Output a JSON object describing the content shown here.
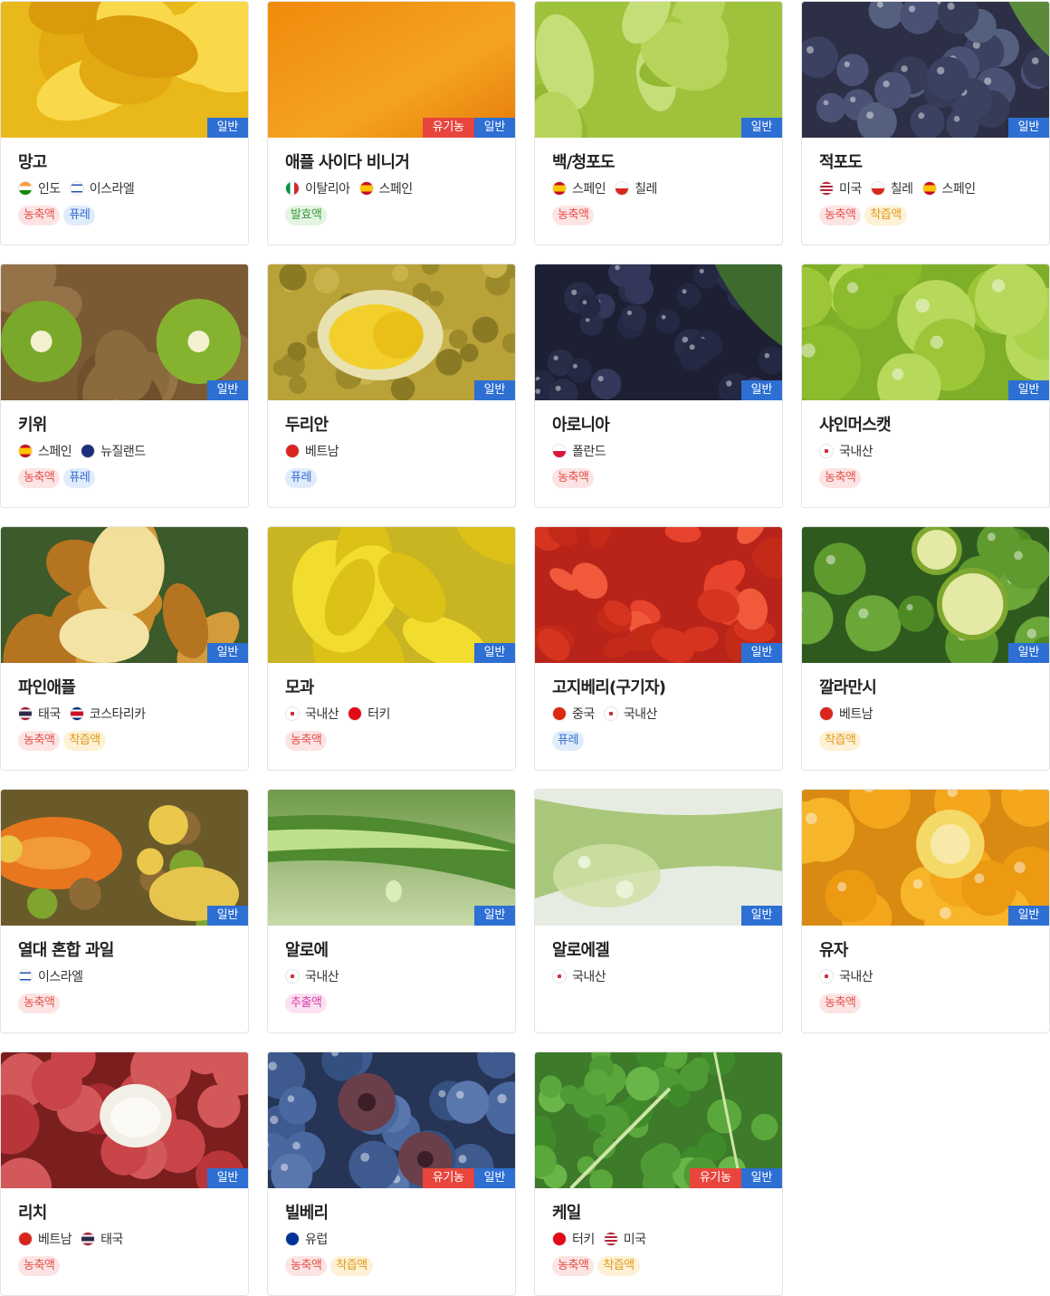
{
  "badge_labels": {
    "general": "일반",
    "organic": "유기농"
  },
  "colors": {
    "general_badge": "#2d6fd3",
    "organic_badge": "#e8453c",
    "tag_concentrate": "#e2524a",
    "tag_puree": "#2e6ad1",
    "tag_fermented": "#3c9a3c",
    "tag_juice": "#e39a1b",
    "tag_extract": "#d93aa8"
  },
  "products": [
    {
      "name": "망고",
      "image": "mango-photo",
      "organic": false,
      "origins": [
        {
          "label": "인도",
          "flag": "india-flag-icon"
        },
        {
          "label": "이스라엘",
          "flag": "israel-flag-icon"
        }
      ],
      "tags": [
        {
          "label": "농축액",
          "type": "conc"
        },
        {
          "label": "퓨레",
          "type": "puree"
        }
      ]
    },
    {
      "name": "애플 사이다 비니거",
      "image": "vinegar-photo",
      "organic": true,
      "origins": [
        {
          "label": "이탈리아",
          "flag": "italy-flag-icon"
        },
        {
          "label": "스페인",
          "flag": "spain-flag-icon"
        }
      ],
      "tags": [
        {
          "label": "발효액",
          "type": "ferm"
        }
      ]
    },
    {
      "name": "백/청포도",
      "image": "green-grape-photo",
      "organic": false,
      "origins": [
        {
          "label": "스페인",
          "flag": "spain-flag-icon"
        },
        {
          "label": "칠레",
          "flag": "chile-flag-icon"
        }
      ],
      "tags": [
        {
          "label": "농축액",
          "type": "conc"
        }
      ]
    },
    {
      "name": "적포도",
      "image": "red-grape-photo",
      "organic": false,
      "origins": [
        {
          "label": "미국",
          "flag": "usa-flag-icon"
        },
        {
          "label": "칠레",
          "flag": "chile-flag-icon"
        },
        {
          "label": "스페인",
          "flag": "spain-flag-icon"
        }
      ],
      "tags": [
        {
          "label": "농축액",
          "type": "conc"
        },
        {
          "label": "착즙액",
          "type": "juice"
        }
      ]
    },
    {
      "name": "키위",
      "image": "kiwi-photo",
      "organic": false,
      "origins": [
        {
          "label": "스페인",
          "flag": "spain-flag-icon"
        },
        {
          "label": "뉴질랜드",
          "flag": "new-zealand-flag-icon"
        }
      ],
      "tags": [
        {
          "label": "농축액",
          "type": "conc"
        },
        {
          "label": "퓨레",
          "type": "puree"
        }
      ]
    },
    {
      "name": "두리안",
      "image": "durian-photo",
      "organic": false,
      "origins": [
        {
          "label": "베트남",
          "flag": "vietnam-flag-icon"
        }
      ],
      "tags": [
        {
          "label": "퓨레",
          "type": "puree"
        }
      ]
    },
    {
      "name": "아로니아",
      "image": "aronia-photo",
      "organic": false,
      "origins": [
        {
          "label": "폴란드",
          "flag": "poland-flag-icon"
        }
      ],
      "tags": [
        {
          "label": "농축액",
          "type": "conc"
        }
      ]
    },
    {
      "name": "샤인머스캣",
      "image": "shine-muscat-photo",
      "organic": false,
      "origins": [
        {
          "label": "국내산",
          "flag": "korea-flag-icon"
        }
      ],
      "tags": [
        {
          "label": "농축액",
          "type": "conc"
        }
      ]
    },
    {
      "name": "파인애플",
      "image": "pineapple-photo",
      "organic": false,
      "origins": [
        {
          "label": "태국",
          "flag": "thailand-flag-icon"
        },
        {
          "label": "코스타리카",
          "flag": "costa-rica-flag-icon"
        }
      ],
      "tags": [
        {
          "label": "농축액",
          "type": "conc"
        },
        {
          "label": "착즙액",
          "type": "juice"
        }
      ]
    },
    {
      "name": "모과",
      "image": "quince-photo",
      "organic": false,
      "origins": [
        {
          "label": "국내산",
          "flag": "korea-flag-icon"
        },
        {
          "label": "터키",
          "flag": "turkey-flag-icon"
        }
      ],
      "tags": [
        {
          "label": "농축액",
          "type": "conc"
        }
      ]
    },
    {
      "name": "고지베리(구기자)",
      "image": "goji-photo",
      "organic": false,
      "origins": [
        {
          "label": "중국",
          "flag": "china-flag-icon"
        },
        {
          "label": "국내산",
          "flag": "korea-flag-icon"
        }
      ],
      "tags": [
        {
          "label": "퓨레",
          "type": "puree"
        }
      ]
    },
    {
      "name": "깔라만시",
      "image": "calamansi-photo",
      "organic": false,
      "origins": [
        {
          "label": "베트남",
          "flag": "vietnam-flag-icon"
        }
      ],
      "tags": [
        {
          "label": "착즙액",
          "type": "juice"
        }
      ]
    },
    {
      "name": "열대 혼합 과일",
      "image": "tropical-photo",
      "organic": false,
      "origins": [
        {
          "label": "이스라엘",
          "flag": "israel-flag-icon"
        }
      ],
      "tags": [
        {
          "label": "농축액",
          "type": "conc"
        }
      ]
    },
    {
      "name": "알로에",
      "image": "aloe-photo",
      "organic": false,
      "origins": [
        {
          "label": "국내산",
          "flag": "korea-flag-icon"
        }
      ],
      "tags": [
        {
          "label": "추출액",
          "type": "extract"
        }
      ]
    },
    {
      "name": "알로에겔",
      "image": "aloe-gel-photo",
      "organic": false,
      "origins": [
        {
          "label": "국내산",
          "flag": "korea-flag-icon"
        }
      ],
      "tags": []
    },
    {
      "name": "유자",
      "image": "yuzu-photo",
      "organic": false,
      "origins": [
        {
          "label": "국내산",
          "flag": "korea-flag-icon"
        }
      ],
      "tags": [
        {
          "label": "농축액",
          "type": "conc"
        }
      ]
    },
    {
      "name": "리치",
      "image": "lychee-photo",
      "organic": false,
      "origins": [
        {
          "label": "베트남",
          "flag": "vietnam-flag-icon"
        },
        {
          "label": "태국",
          "flag": "thailand-flag-icon"
        }
      ],
      "tags": [
        {
          "label": "농축액",
          "type": "conc"
        }
      ]
    },
    {
      "name": "빌베리",
      "image": "bilberry-photo",
      "organic": true,
      "origins": [
        {
          "label": "유럽",
          "flag": "eu-flag-icon"
        }
      ],
      "tags": [
        {
          "label": "농축액",
          "type": "conc"
        },
        {
          "label": "착즙액",
          "type": "juice"
        }
      ]
    },
    {
      "name": "케일",
      "image": "kale-photo",
      "organic": true,
      "origins": [
        {
          "label": "터키",
          "flag": "turkey-flag-icon"
        },
        {
          "label": "미국",
          "flag": "usa-flag-icon"
        }
      ],
      "tags": [
        {
          "label": "농축액",
          "type": "conc"
        },
        {
          "label": "착즙액",
          "type": "juice"
        }
      ]
    }
  ]
}
